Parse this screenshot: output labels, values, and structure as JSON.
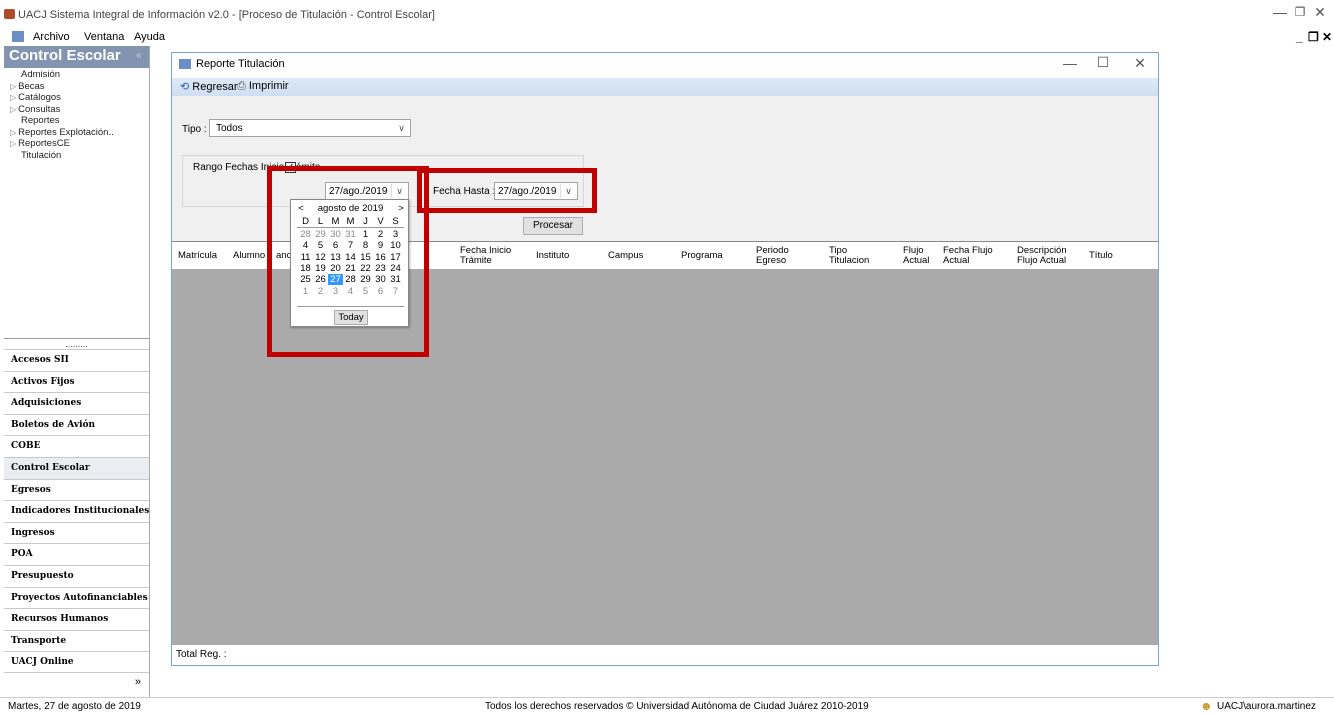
{
  "window": {
    "title": "UACJ Sistema Integral de Información v2.0 - [Proceso de Titulación - Control Escolar]"
  },
  "menu": {
    "items": [
      "Archivo",
      "Ventana",
      "Ayuda"
    ]
  },
  "left_panel": {
    "header": "Control Escolar",
    "tree": [
      {
        "label": "Admisión",
        "expandable": false
      },
      {
        "label": "Becas",
        "expandable": true
      },
      {
        "label": "Catálogos",
        "expandable": true
      },
      {
        "label": "Consultas",
        "expandable": true
      },
      {
        "label": "Reportes",
        "expandable": false
      },
      {
        "label": "Reportes Explotación..",
        "expandable": true
      },
      {
        "label": "ReportesCE",
        "expandable": true
      },
      {
        "label": "Titulación",
        "expandable": false
      }
    ],
    "modules": [
      "Accesos SII",
      "Activos Fijos",
      "Adquisiciones",
      "Boletos de Avión",
      "COBE",
      "Control Escolar",
      "Egresos",
      "Indicadores Institucionales",
      "Ingresos",
      "POA",
      "Presupuesto",
      "Proyectos Autofinanciables",
      "Recursos Humanos",
      "Transporte",
      "UACJ Online"
    ],
    "active_module": "Control Escolar"
  },
  "child_window": {
    "title": "Reporte Titulación",
    "toolbar": {
      "regresar": "Regresar",
      "imprimir": "Imprimir"
    },
    "tipo_label": "Tipo :",
    "tipo_value": "Todos",
    "rango_label": "Rango Fechas Inicio Trámite",
    "rango_checked": "✓",
    "fecha_desde": "27/ago./2019",
    "fecha_hasta_label": "Fecha Hasta :",
    "fecha_hasta": "27/ago./2019",
    "procesar": "Procesar",
    "columns": [
      {
        "l1": "Matrícula",
        "l2": ""
      },
      {
        "l1": "Alumno",
        "l2": ""
      },
      {
        "l1": "ancia",
        "l2": ""
      },
      {
        "l1": "Fecha Inicio",
        "l2": "Trámite"
      },
      {
        "l1": "Instituto",
        "l2": ""
      },
      {
        "l1": "Campus",
        "l2": ""
      },
      {
        "l1": "Programa",
        "l2": ""
      },
      {
        "l1": "Periodo",
        "l2": "Egreso"
      },
      {
        "l1": "Tipo",
        "l2": "Titulacion"
      },
      {
        "l1": "Flujo",
        "l2": "Actual"
      },
      {
        "l1": "Fecha Flujo",
        "l2": "Actual"
      },
      {
        "l1": "Descripción",
        "l2": "Flujo Actual"
      },
      {
        "l1": "Título",
        "l2": ""
      }
    ],
    "total_label": "Total Reg. :"
  },
  "calendar": {
    "month_label": "agosto de 2019",
    "weekdays": [
      "D",
      "L",
      "M",
      "M",
      "J",
      "V",
      "S"
    ],
    "weeks": [
      [
        "28",
        "29",
        "30",
        "31",
        "1",
        "2",
        "3"
      ],
      [
        "4",
        "5",
        "6",
        "7",
        "8",
        "9",
        "10"
      ],
      [
        "11",
        "12",
        "13",
        "14",
        "15",
        "16",
        "17"
      ],
      [
        "18",
        "19",
        "20",
        "21",
        "22",
        "23",
        "24"
      ],
      [
        "25",
        "26",
        "27",
        "28",
        "29",
        "30",
        "31"
      ],
      [
        "1",
        "2",
        "3",
        "4",
        "5",
        "6",
        "7"
      ]
    ],
    "selected_day": "27",
    "today_label": "Today"
  },
  "status": {
    "date": "Martes, 27 de agosto de 2019",
    "copyright": "Todos los derechos reservados © Universidad Autónoma de Ciudad Juárez 2010-2019",
    "user": "UACJ\\aurora.martinez"
  },
  "colors": {
    "annotation": "#c00000",
    "header": "#8394b0",
    "selected_day": "#3399ff"
  }
}
